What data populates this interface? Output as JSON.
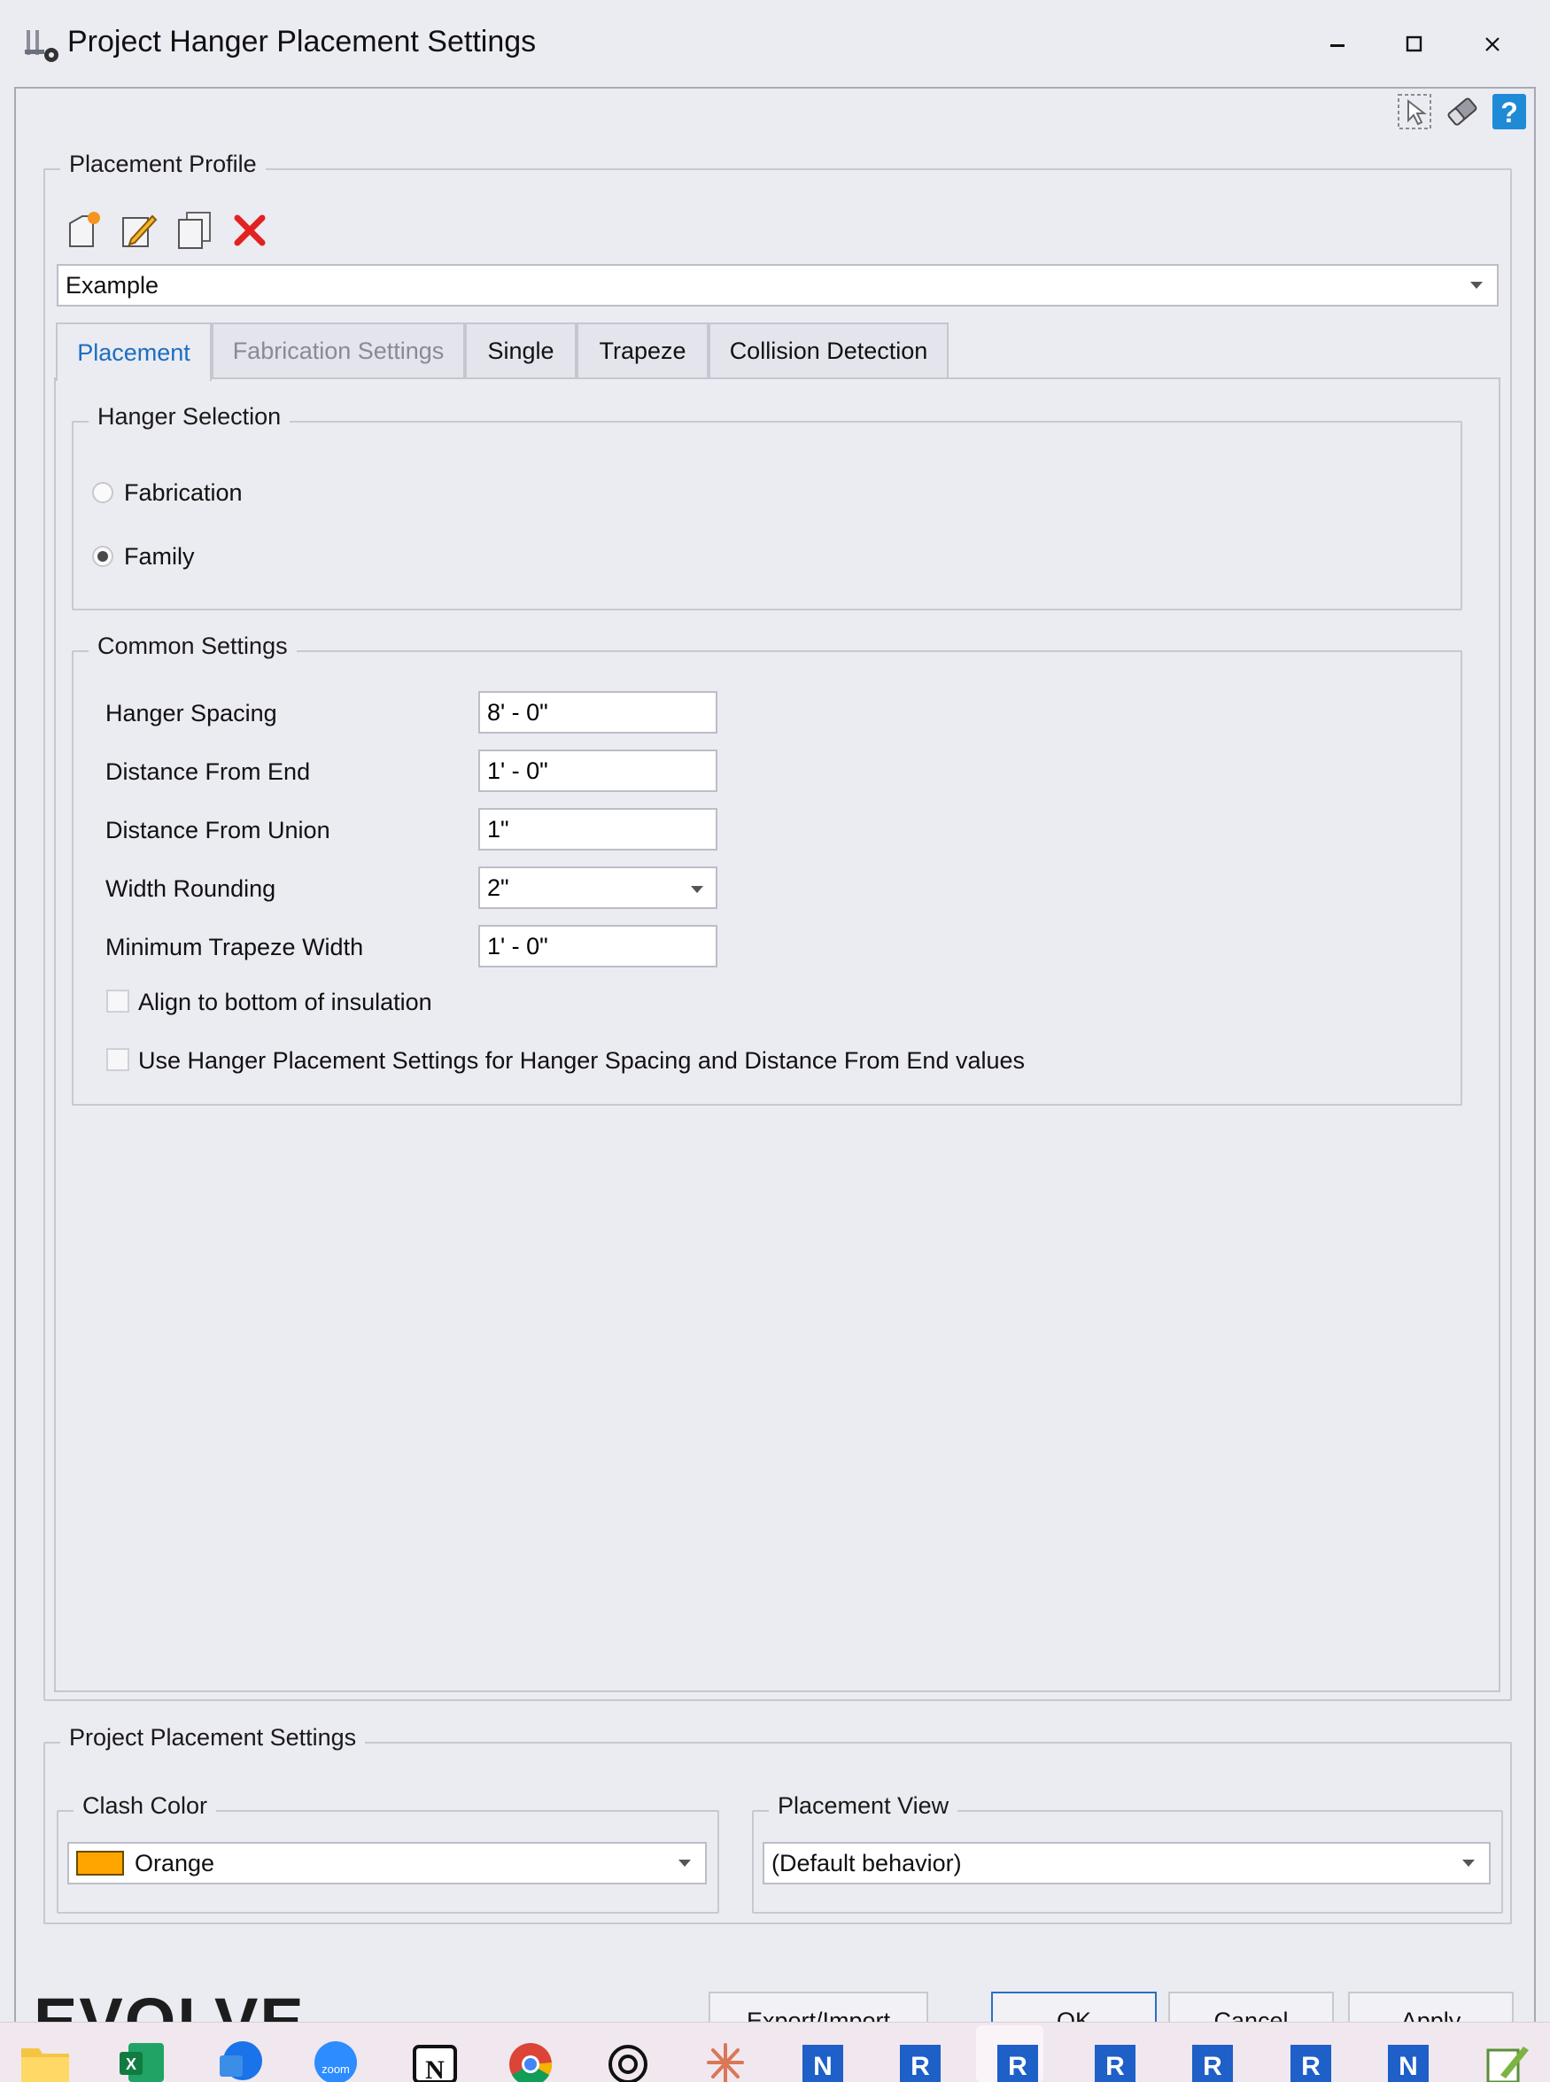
{
  "window": {
    "title": "Project Hanger Placement Settings",
    "controls": {
      "minimize": "minimize",
      "maximize": "maximize",
      "close": "close"
    }
  },
  "top_toolbar_icons": [
    "select-element-icon",
    "eraser-icon",
    "help-icon"
  ],
  "placement_profile": {
    "label": "Placement Profile",
    "tools": [
      "new-profile-icon",
      "edit-profile-icon",
      "copy-profile-icon",
      "delete-profile-icon"
    ],
    "selected": "Example"
  },
  "tabs": [
    {
      "label": "Placement",
      "state": "active"
    },
    {
      "label": "Fabrication Settings",
      "state": "disabled"
    },
    {
      "label": "Single",
      "state": "normal"
    },
    {
      "label": "Trapeze",
      "state": "normal"
    },
    {
      "label": "Collision Detection",
      "state": "normal"
    }
  ],
  "hanger_selection": {
    "label": "Hanger Selection",
    "options": [
      {
        "label": "Fabrication",
        "checked": false
      },
      {
        "label": "Family",
        "checked": true
      }
    ]
  },
  "common_settings": {
    "label": "Common Settings",
    "fields": [
      {
        "label": "Hanger Spacing",
        "value": "8' - 0\""
      },
      {
        "label": "Distance From End",
        "value": "1' - 0\""
      },
      {
        "label": "Distance From Union",
        "value": "1\""
      },
      {
        "label": "Width Rounding",
        "value": "2\""
      },
      {
        "label": "Minimum Trapeze Width",
        "value": "1' - 0\""
      }
    ],
    "checkboxes": [
      {
        "label": "Align to bottom of insulation",
        "checked": false
      },
      {
        "label": "Use Hanger Placement Settings for Hanger Spacing and Distance From End values",
        "checked": false
      }
    ]
  },
  "project_placement": {
    "label": "Project Placement Settings",
    "clash_color": {
      "label": "Clash Color",
      "value": "Orange",
      "swatch": "#FFA500"
    },
    "placement_view": {
      "label": "Placement View",
      "value": "(Default behavior)"
    }
  },
  "brand": "EVOLVE",
  "buttons": {
    "export_import": "Export/Import",
    "ok": "OK",
    "cancel": "Cancel",
    "apply": "Apply"
  },
  "taskbar": [
    "file-explorer-icon",
    "excel-icon",
    "sharepoint-icon",
    "zoom-icon",
    "notion-icon",
    "chrome-icon",
    "openai-icon",
    "claude-icon",
    "revit-n-icon",
    "revit-r-icon",
    "revit-r-icon",
    "revit-r-icon",
    "revit-r-icon",
    "revit-r-icon",
    "revit-n-icon",
    "notepad-icon"
  ],
  "colors": {
    "accent": "#1A6FC0",
    "window_bg": "#EBEBF2",
    "delete_red": "#E22222"
  }
}
